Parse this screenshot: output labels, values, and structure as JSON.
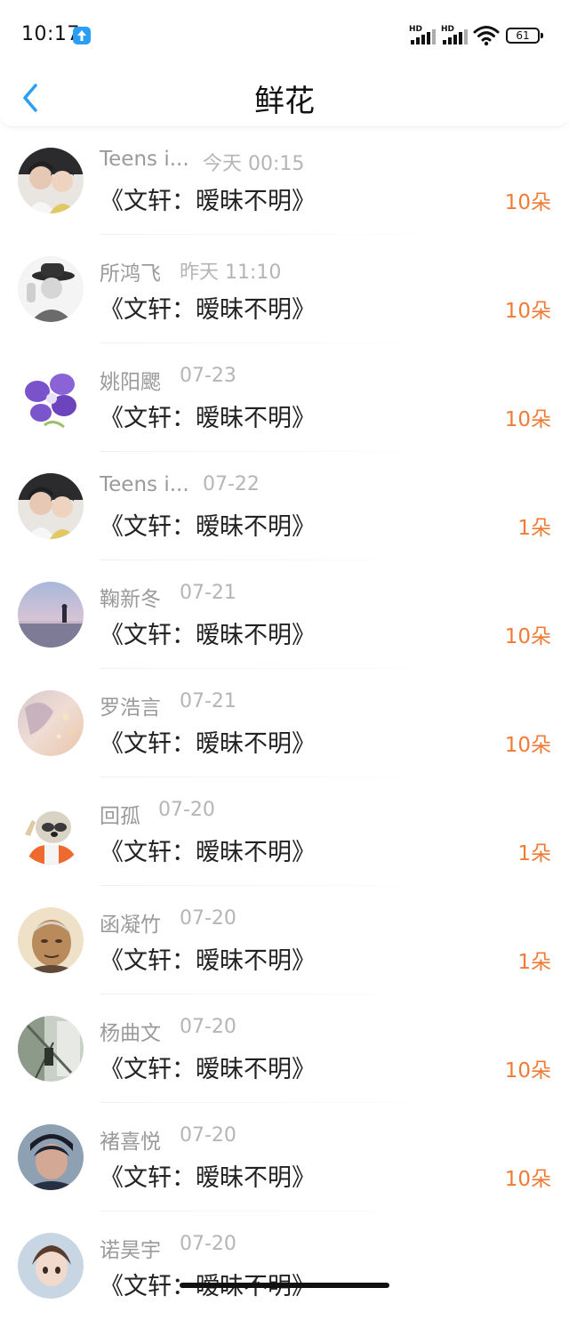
{
  "status_bar": {
    "time": "10:17",
    "network_1": "HD",
    "network_2": "HD",
    "battery": "61"
  },
  "header": {
    "title": "鲜花",
    "back_icon": "chevron-left-icon"
  },
  "colors": {
    "accent_blue": "#2a9df4",
    "count_orange": "#ef7b36",
    "meta_gray": "#9a9a9a"
  },
  "rows": [
    {
      "name": "Teens i...",
      "date": "今天 00:15",
      "title": "《文轩：暧昧不明》",
      "count": "10朵",
      "avatar": "two-boys-photo"
    },
    {
      "name": "所鸿飞",
      "date": "昨天 11:10",
      "title": "《文轩：暧昧不明》",
      "count": "10朵",
      "avatar": "man-in-hat-photo"
    },
    {
      "name": "姚阳颸",
      "date": "07-23",
      "title": "《文轩：暧昧不明》",
      "count": "10朵",
      "avatar": "purple-orchid-photo"
    },
    {
      "name": "Teens i...",
      "date": "07-22",
      "title": "《文轩：暧昧不明》",
      "count": "1朵",
      "avatar": "two-boys-photo"
    },
    {
      "name": "鞠新冬",
      "date": "07-21",
      "title": "《文轩：暧昧不明》",
      "count": "10朵",
      "avatar": "seaside-figure-photo"
    },
    {
      "name": "罗浩言",
      "date": "07-21",
      "title": "《文轩：暧昧不明》",
      "count": "10朵",
      "avatar": "pastel-anime-photo"
    },
    {
      "name": "回孤",
      "date": "07-20",
      "title": "《文轩：暧昧不明》",
      "count": "1朵",
      "avatar": "sloth-cartoon"
    },
    {
      "name": "函凝竹",
      "date": "07-20",
      "title": "《文轩：暧昧不明》",
      "count": "1朵",
      "avatar": "elderly-man-photo"
    },
    {
      "name": "杨曲文",
      "date": "07-20",
      "title": "《文轩：暧昧不明》",
      "count": "10朵",
      "avatar": "street-scene-photo"
    },
    {
      "name": "褚喜悦",
      "date": "07-20",
      "title": "《文轩：暧昧不明》",
      "count": "10朵",
      "avatar": "boy-portrait-photo"
    },
    {
      "name": "诺昊宇",
      "date": "07-20",
      "title": "《文轩：暧昧不明》",
      "count": "",
      "avatar": "anime-portrait-photo"
    }
  ]
}
